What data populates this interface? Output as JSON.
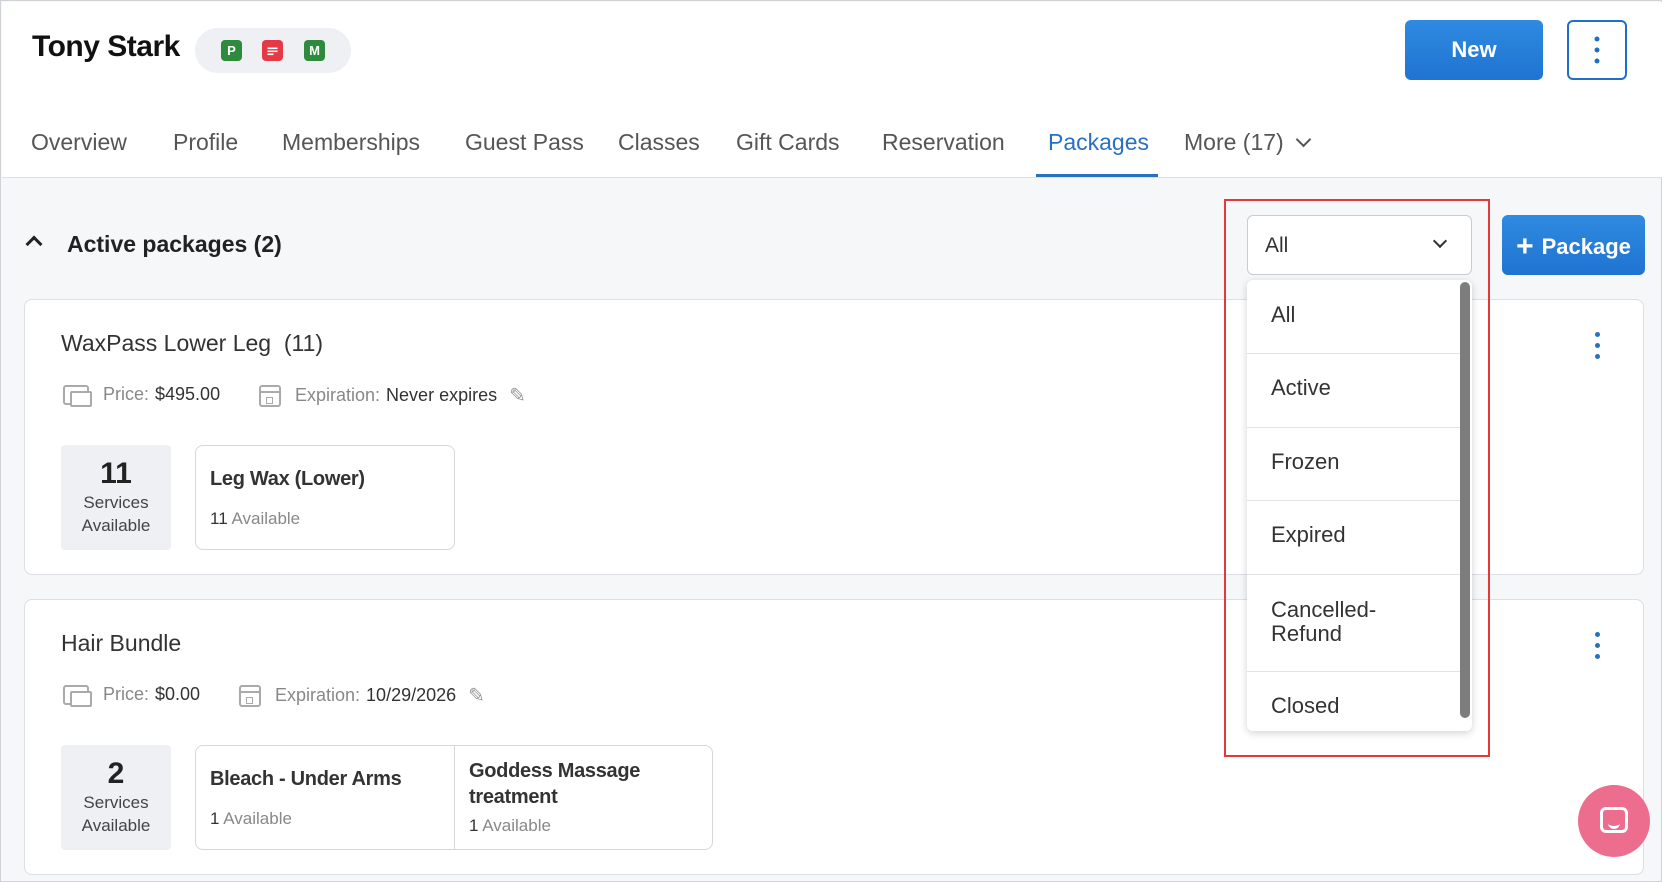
{
  "header": {
    "customer_name": "Tony Stark",
    "badges": [
      {
        "icon": "parking-badge-icon",
        "text": "P",
        "color": "#2e8b3d"
      },
      {
        "icon": "chat-badge-icon",
        "text": "",
        "color": "#e53946"
      },
      {
        "icon": "membership-badge-icon",
        "text": "M",
        "color": "#2e8b3d"
      }
    ],
    "new_button": "New"
  },
  "tabs": [
    {
      "label": "Overview"
    },
    {
      "label": "Profile"
    },
    {
      "label": "Memberships"
    },
    {
      "label": "Guest Pass"
    },
    {
      "label": "Classes"
    },
    {
      "label": "Gift Cards"
    },
    {
      "label": "Reservation"
    },
    {
      "label": "Packages",
      "active": true
    },
    {
      "label": "More (17)"
    }
  ],
  "section": {
    "title": "Active packages (2)",
    "filter_value": "All",
    "package_button": "Package"
  },
  "packages": [
    {
      "name": "WaxPass Lower Leg",
      "count": "(11)",
      "price_label": "Price:",
      "price": "$495.00",
      "expiration_label": "Expiration:",
      "expiration": "Never expires",
      "services_total": "11",
      "services_label_1": "Services",
      "services_label_2": "Available",
      "services": [
        {
          "name": "Leg Wax (Lower)",
          "available_count": "11",
          "available_text": "Available"
        }
      ]
    },
    {
      "name": "Hair Bundle",
      "count": "",
      "price_label": "Price:",
      "price": "$0.00",
      "expiration_label": "Expiration:",
      "expiration": "10/29/2026",
      "services_total": "2",
      "services_label_1": "Services",
      "services_label_2": "Available",
      "services": [
        {
          "name": "Bleach - Under Arms",
          "available_count": "1",
          "available_text": "Available"
        },
        {
          "name": "Goddess Massage treatment",
          "available_count": "1",
          "available_text": "Available"
        }
      ]
    }
  ],
  "dropdown": {
    "options": [
      "All",
      "Active",
      "Frozen",
      "Expired",
      "Cancelled-Refund",
      "Closed"
    ]
  },
  "colors": {
    "accent": "#2a6fc2",
    "primary_button": "#1f74d1",
    "highlight": "#e5383b",
    "chat": "#ec6d8e"
  }
}
